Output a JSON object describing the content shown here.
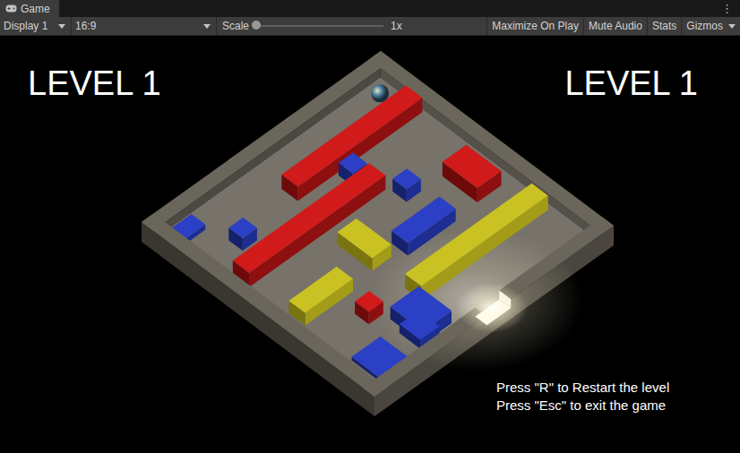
{
  "window": {
    "tab": "Game",
    "menu_icon": "⋮"
  },
  "toolbar": {
    "display": "Display 1",
    "aspect": "16:9",
    "scale_label": "Scale",
    "scale": {
      "level": 0
    },
    "scale_value": "1x",
    "toggles": [
      {
        "label": "Maximize On Play",
        "on": false,
        "kind": "button"
      },
      {
        "label": "Mute Audio",
        "on": false,
        "kind": "button"
      },
      {
        "label": "Stats",
        "on": false,
        "kind": "button"
      },
      {
        "label": "Gizmos",
        "on": false,
        "kind": "dropdown"
      }
    ]
  },
  "hud": {
    "level_left": "LEVEL 1",
    "level_right": "LEVEL 1",
    "instructions": [
      "Press \"R\" to Restart the level",
      "Press \"Esc\" to exit the game"
    ]
  }
}
